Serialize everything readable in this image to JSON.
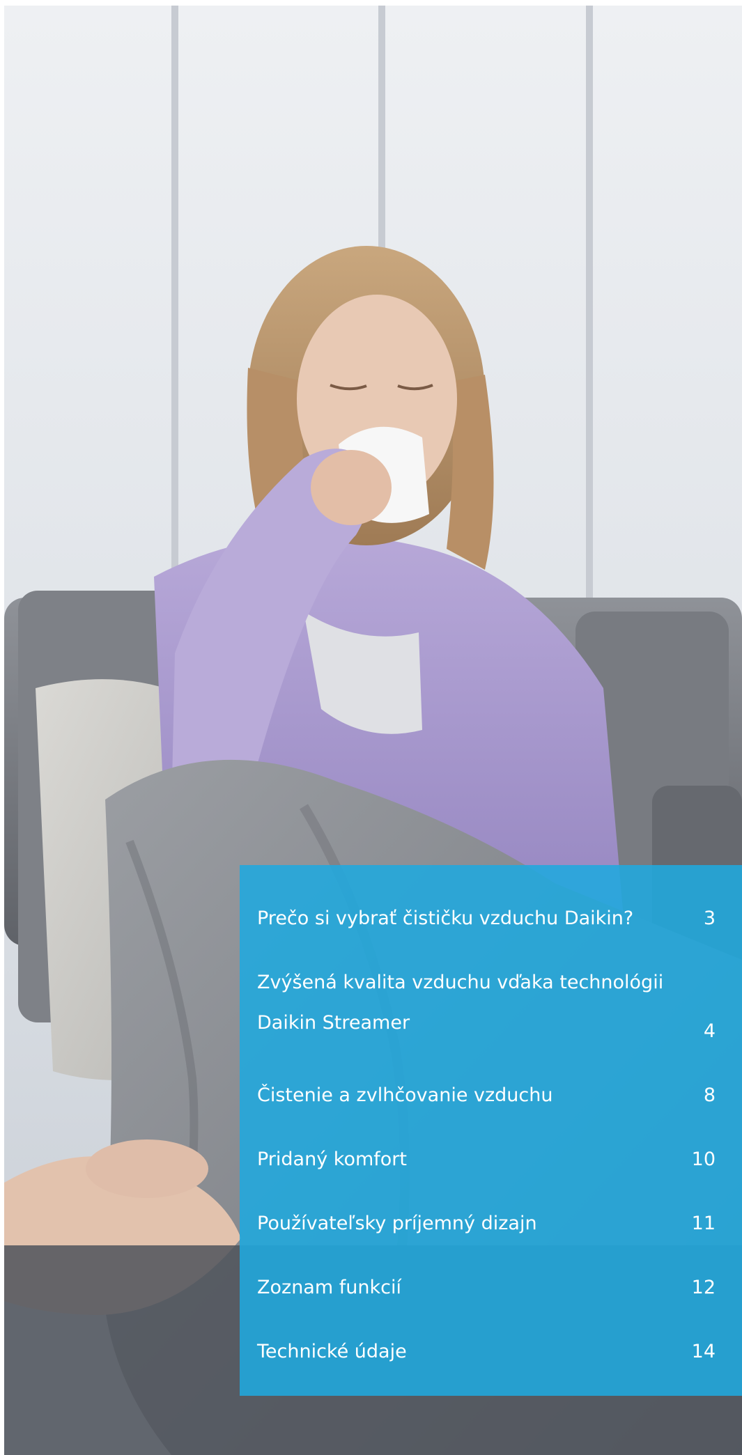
{
  "photo": {
    "icon": "woman-blowing-nose-photo"
  },
  "toc": {
    "accent_color": "#20a9de",
    "items": [
      {
        "label": "Prečo si vybrať čističku vzduchu Daikin?",
        "page": "3"
      },
      {
        "label": "Zvýšená kvalita vzduchu vďaka technológii Daikin Streamer",
        "page": "4"
      },
      {
        "label": "Čistenie a zvlhčovanie vzduchu",
        "page": "8"
      },
      {
        "label": "Pridaný komfort",
        "page": "10"
      },
      {
        "label": "Používateľsky príjemný dizajn",
        "page": "11"
      },
      {
        "label": "Zoznam funkcií",
        "page": "12"
      },
      {
        "label": "Technické údaje",
        "page": "14"
      }
    ]
  }
}
